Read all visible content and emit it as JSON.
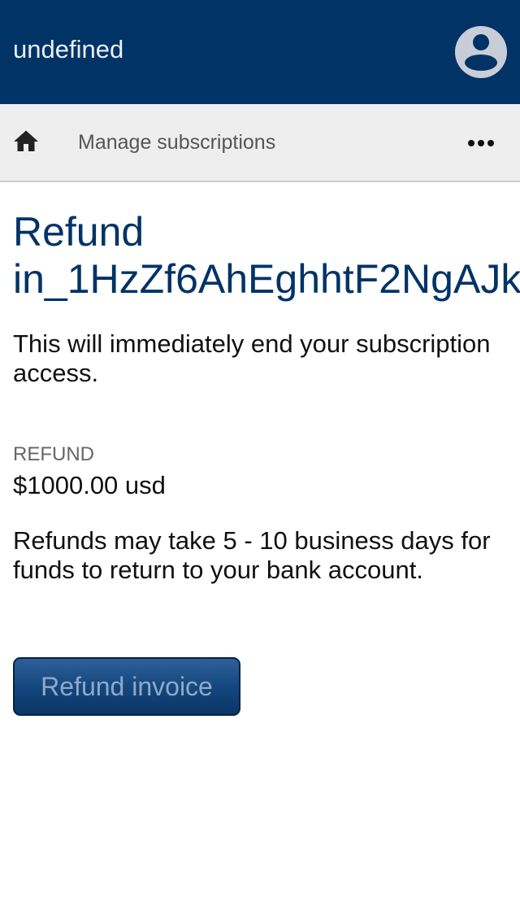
{
  "header": {
    "app_title": "undefined",
    "avatar_icon": "account-circle-icon",
    "background_color": "#023366"
  },
  "subnav": {
    "home_icon": "home-icon",
    "link_label": "Manage subscriptions",
    "more_icon": "more-horizontal-icon"
  },
  "main": {
    "title_line1": "Refund",
    "title_line2": "in_1HzZf6AhEghhtF2NgAJk",
    "warning": "This will immediately end your subscription access.",
    "refund_label": "REFUND",
    "refund_amount": "$1000.00 usd",
    "refund_note": "Refunds may take 5 - 10 business days for funds to return to your bank account.",
    "refund_button_label": "Refund invoice",
    "title_color": "#023366"
  }
}
